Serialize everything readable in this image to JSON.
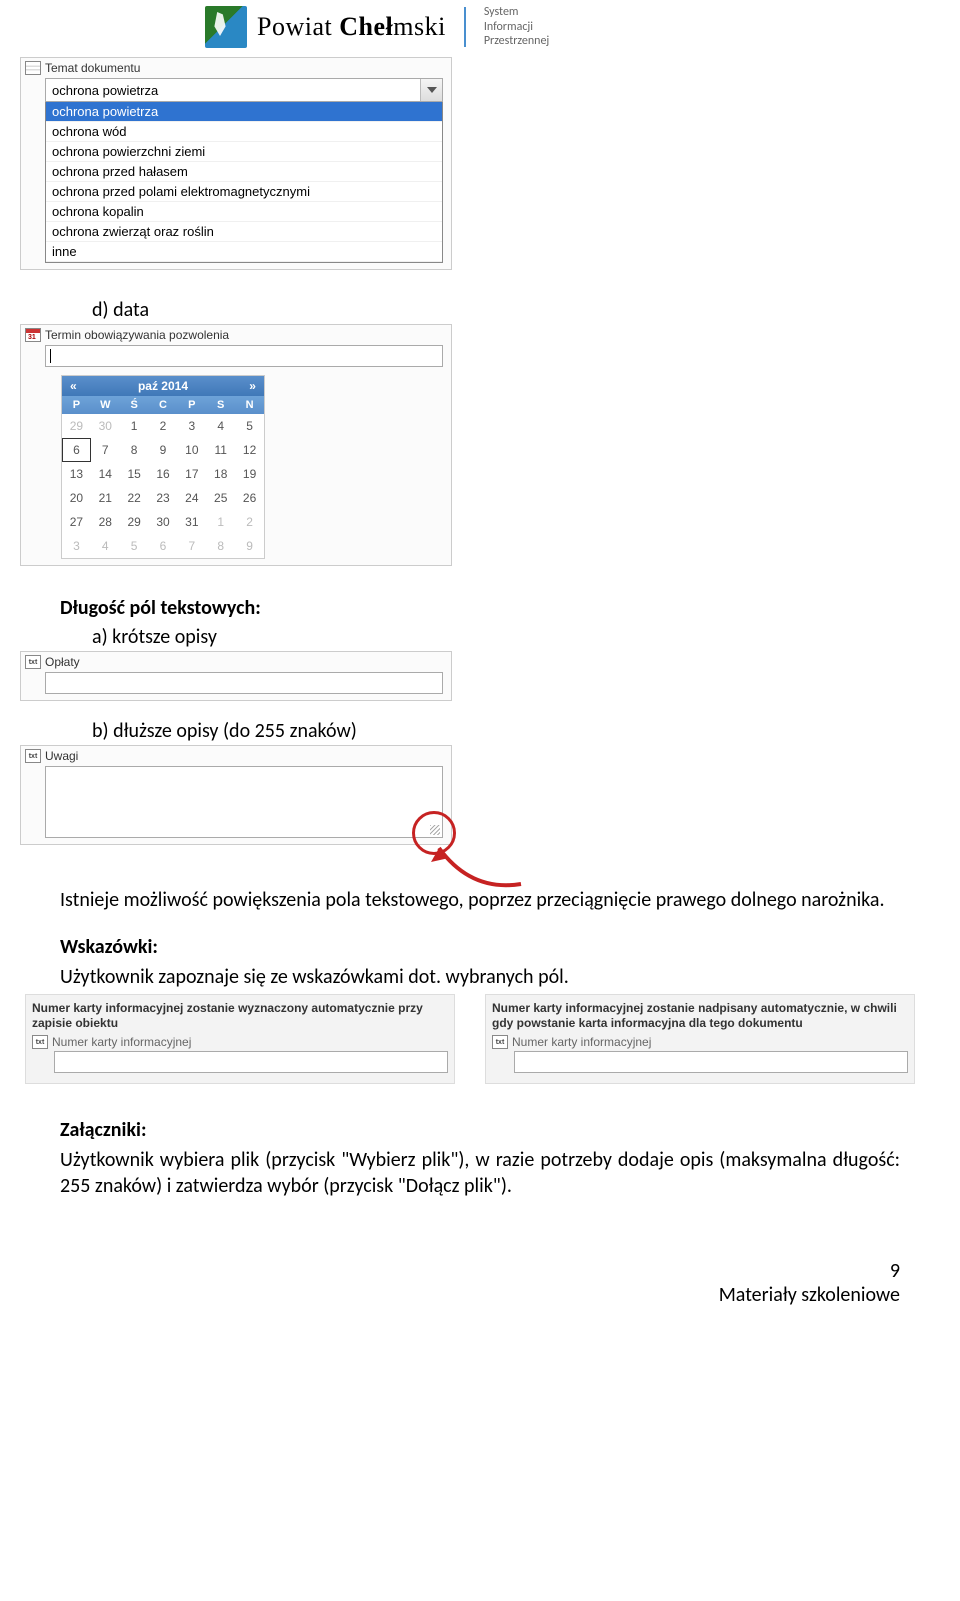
{
  "header": {
    "brand_prefix": "Powiat ",
    "brand_bold": "Cheł",
    "brand_suffix": "mski",
    "sub1": "System",
    "sub2": "Informacji",
    "sub3": "Przestrzennej"
  },
  "topic": {
    "label": "Temat dokumentu",
    "selected": "ochrona powietrza",
    "options": [
      "ochrona powietrza",
      "ochrona wód",
      "ochrona powierzchni ziemi",
      "ochrona przed hałasem",
      "ochrona przed polami elektromagnetycznymi",
      "ochrona kopalin",
      "ochrona zwierząt oraz roślin",
      "inne"
    ]
  },
  "section_d": {
    "marker": "d)",
    "text": "data"
  },
  "date_field": {
    "label": "Termin obowiązywania pozwolenia",
    "month": "paź 2014",
    "prev": "«",
    "next": "»",
    "dow": [
      "P",
      "W",
      "Ś",
      "C",
      "P",
      "S",
      "N"
    ],
    "cells": [
      {
        "v": "29",
        "m": true
      },
      {
        "v": "30",
        "m": true
      },
      {
        "v": "1"
      },
      {
        "v": "2"
      },
      {
        "v": "3"
      },
      {
        "v": "4"
      },
      {
        "v": "5"
      },
      {
        "v": "6",
        "t": true
      },
      {
        "v": "7"
      },
      {
        "v": "8"
      },
      {
        "v": "9"
      },
      {
        "v": "10"
      },
      {
        "v": "11"
      },
      {
        "v": "12"
      },
      {
        "v": "13"
      },
      {
        "v": "14"
      },
      {
        "v": "15"
      },
      {
        "v": "16"
      },
      {
        "v": "17"
      },
      {
        "v": "18"
      },
      {
        "v": "19"
      },
      {
        "v": "20"
      },
      {
        "v": "21"
      },
      {
        "v": "22"
      },
      {
        "v": "23"
      },
      {
        "v": "24"
      },
      {
        "v": "25"
      },
      {
        "v": "26"
      },
      {
        "v": "27"
      },
      {
        "v": "28"
      },
      {
        "v": "29"
      },
      {
        "v": "30"
      },
      {
        "v": "31"
      },
      {
        "v": "1",
        "m": true
      },
      {
        "v": "2",
        "m": true
      },
      {
        "v": "3",
        "m": true
      },
      {
        "v": "4",
        "m": true
      },
      {
        "v": "5",
        "m": true
      },
      {
        "v": "6",
        "m": true
      },
      {
        "v": "7",
        "m": true
      },
      {
        "v": "8",
        "m": true
      },
      {
        "v": "9",
        "m": true
      }
    ]
  },
  "length_heading": "Długość pól tekstowych:",
  "item_a": {
    "marker": "a)",
    "text": "krótsze opisy"
  },
  "oplaty_label": "Opłaty",
  "item_b": {
    "marker": "b)",
    "text": "dłuższe opisy (do 255 znaków)"
  },
  "uwagi_label": "Uwagi",
  "resize_text": "Istnieje możliwość powiększenia pola tekstowego, poprzez przeciągnięcie prawego dolnego narożnika.",
  "hints_heading": "Wskazówki:",
  "hints_text": "Użytkownik zapoznaje się ze wskazówkami dot. wybranych pól.",
  "panel_left": {
    "note": "Numer karty informacyjnej zostanie wyznaczony automatycznie przy zapisie obiektu",
    "field_label": "Numer karty informacyjnej"
  },
  "panel_right": {
    "note": "Numer karty informacyjnej zostanie nadpisany automatycznie, w chwili gdy powstanie karta informacyjna dla tego dokumentu",
    "field_label": "Numer karty informacyjnej"
  },
  "attach_heading": "Załączniki:",
  "attach_text": "Użytkownik wybiera plik (przycisk \"Wybierz plik\"), w razie potrzeby dodaje opis (maksymalna długość: 255 znaków) i zatwierdza wybór (przycisk \"Dołącz plik\").",
  "footer": {
    "page": "9",
    "mat": "Materiały szkoleniowe"
  }
}
